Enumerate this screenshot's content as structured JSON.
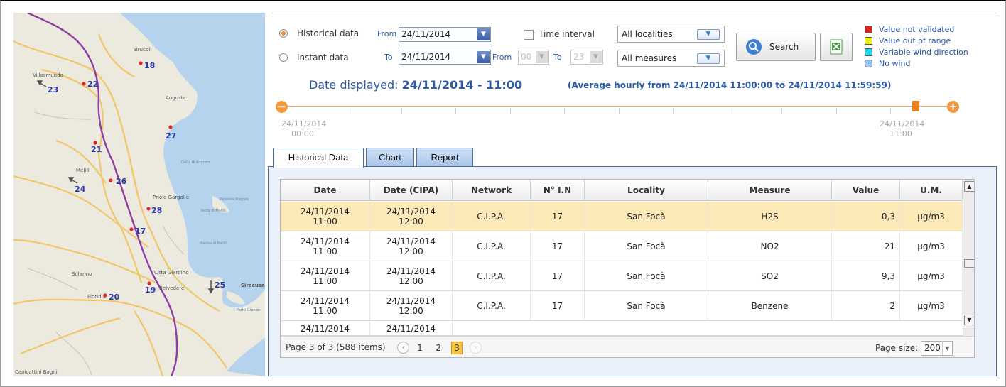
{
  "map": {
    "places": [
      "Villasmundo",
      "Brucoli",
      "Augusta",
      "Melilli",
      "Priolo Gargallo",
      "Citta Giardino",
      "Solarino",
      "Belvedere",
      "Floridia",
      "Siracusa",
      "Canicattini Bagni",
      "Golfo di Augusta",
      "Penisola Magnisi",
      "Rada di Melilli",
      "Marina di Melilli",
      "Porto Grande"
    ],
    "stations": [
      "18",
      "22",
      "23",
      "27",
      "21",
      "24",
      "26",
      "28",
      "17",
      "19",
      "20",
      "25"
    ]
  },
  "filters": {
    "historical_label": "Historical data",
    "instant_label": "Instant data",
    "from_label": "From",
    "to_label": "To",
    "from_date": "24/11/2014",
    "to_date": "24/11/2014",
    "hour_from_label": "From",
    "hour_to_label": "To",
    "hour_from": "00",
    "hour_to": "23",
    "time_interval_label": "Time interval",
    "localities": "All localities",
    "measures": "All measures",
    "search_label": "Search"
  },
  "legend": {
    "items": [
      {
        "label": "Value not validated",
        "color": "#e02020"
      },
      {
        "label": "Value out of range",
        "color": "#f4f000"
      },
      {
        "label": "Variable wind direction",
        "color": "#19d9e6"
      },
      {
        "label": "No wind",
        "color": "#8fc2ee"
      }
    ]
  },
  "display": {
    "prefix": "Date displayed:",
    "value": "24/11/2014 - 11:00",
    "average": "(Average hourly from 24/11/2014 11:00:00 to 24/11/2014 11:59:59)"
  },
  "slider": {
    "start_date": "24/11/2014",
    "start_time": "00:00",
    "end_date": "24/11/2014",
    "end_time": "11:00",
    "minus": "−",
    "plus": "+"
  },
  "tabs": [
    "Historical Data",
    "Chart",
    "Report"
  ],
  "table": {
    "columns": [
      "Date",
      "Date (CIPA)",
      "Network",
      "N° I.N",
      "Locality",
      "Measure",
      "Value",
      "U.M."
    ],
    "rows": [
      {
        "date": "24/11/2014",
        "time": "11:00",
        "cdate": "24/11/2014",
        "ctime": "12:00",
        "network": "C.I.P.A.",
        "in": "17",
        "locality": "San Focà",
        "measure": "H2S",
        "value": "0,3",
        "um": "µg/m3"
      },
      {
        "date": "24/11/2014",
        "time": "11:00",
        "cdate": "24/11/2014",
        "ctime": "12:00",
        "network": "C.I.P.A.",
        "in": "17",
        "locality": "San Focà",
        "measure": "NO2",
        "value": "21",
        "um": "µg/m3"
      },
      {
        "date": "24/11/2014",
        "time": "11:00",
        "cdate": "24/11/2014",
        "ctime": "12:00",
        "network": "C.I.P.A.",
        "in": "17",
        "locality": "San Focà",
        "measure": "SO2",
        "value": "9,3",
        "um": "µg/m3"
      },
      {
        "date": "24/11/2014",
        "time": "11:00",
        "cdate": "24/11/2014",
        "ctime": "12:00",
        "network": "C.I.P.A.",
        "in": "17",
        "locality": "San Focà",
        "measure": "Benzene",
        "value": "2",
        "um": "µg/m3"
      },
      {
        "date": "24/11/2014",
        "time": "",
        "cdate": "24/11/2014",
        "ctime": "",
        "network": "",
        "in": "",
        "locality": "",
        "measure": "",
        "value": "",
        "um": ""
      }
    ]
  },
  "pager": {
    "summary": "Page 3 of 3 (588 items)",
    "pages": [
      "1",
      "2",
      "3"
    ],
    "current": "3",
    "size_label": "Page size:",
    "size_value": "200"
  }
}
